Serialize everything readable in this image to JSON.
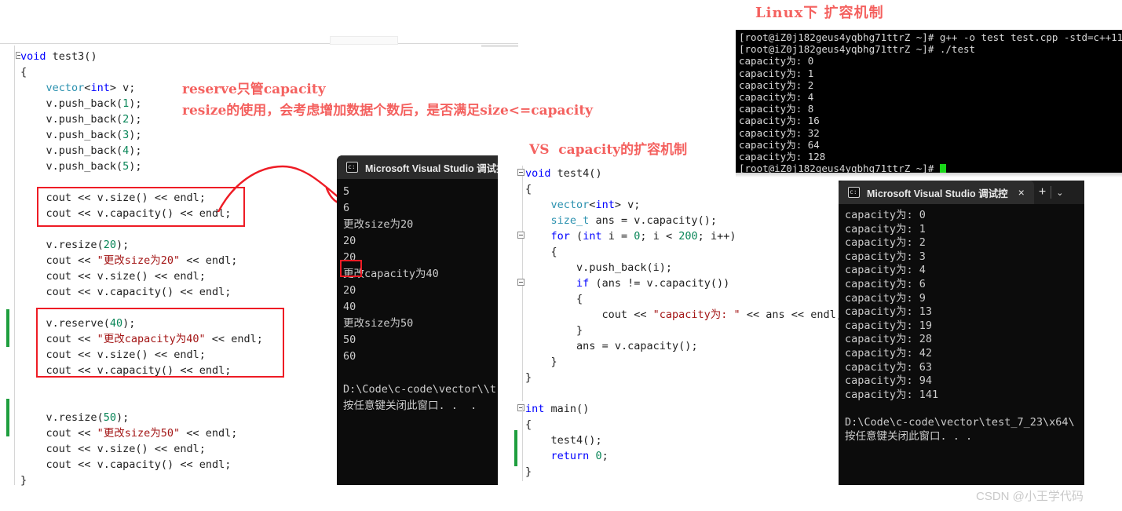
{
  "annotations": {
    "linux_title": "Linux下 扩容机制",
    "reserve_note_line1": "reserve只管capacity",
    "reserve_note_line2": "resize的使用，会考虑增加数据个数后，是否满足size<=capacity",
    "vs_title": "VS  capacity的扩容机制"
  },
  "watermark": "CSDN @小王学代码",
  "code_left": {
    "lines": [
      "void test3()",
      "{",
      "    vector<int> v;",
      "    v.push_back(1);",
      "    v.push_back(2);",
      "    v.push_back(3);",
      "    v.push_back(4);",
      "    v.push_back(5);",
      "",
      "    cout << v.size() << endl;",
      "    cout << v.capacity() << endl;",
      "",
      "    v.resize(20);",
      "    cout << \"更改size为20\" << endl;",
      "    cout << v.size() << endl;",
      "    cout << v.capacity() << endl;",
      "",
      "    v.reserve(40);",
      "    cout << \"更改capacity为40\" << endl;",
      "    cout << v.size() << endl;",
      "    cout << v.capacity() << endl;",
      "",
      "",
      "    v.resize(50);",
      "    cout << \"更改size为50\" << endl;",
      "    cout << v.size() << endl;",
      "    cout << v.capacity() << endl;",
      "}"
    ]
  },
  "code_right": {
    "lines": [
      "void test4()",
      "{",
      "    vector<int> v;",
      "    size_t ans = v.capacity();",
      "    for (int i = 0; i < 200; i++)",
      "    {",
      "        v.push_back(i);",
      "        if (ans != v.capacity())",
      "        {",
      "            cout << \"capacity为: \" << ans << endl;",
      "        }",
      "        ans = v.capacity();",
      "    }",
      "}",
      "",
      "int main()",
      "{",
      "    test4();",
      "    return 0;",
      "}"
    ]
  },
  "console_left": {
    "title": "Microsoft Visual Studio 调试控",
    "lines": [
      "5",
      "6",
      "更改size为20",
      "20",
      "20",
      "更改capacity为40",
      "20",
      "40",
      "更改size为50",
      "50",
      "60",
      "",
      "D:\\Code\\c-code\\vector\\\\t",
      "按任意键关闭此窗口. .  ."
    ]
  },
  "console_right": {
    "title": "Microsoft Visual Studio 调试控",
    "close_icon": "×",
    "plus_icon": "+",
    "chevron_icon": "⌄",
    "lines": [
      "capacity为: 0",
      "capacity为: 1",
      "capacity为: 2",
      "capacity为: 3",
      "capacity为: 4",
      "capacity为: 6",
      "capacity为: 9",
      "capacity为: 13",
      "capacity为: 19",
      "capacity为: 28",
      "capacity为: 42",
      "capacity为: 63",
      "capacity为: 94",
      "capacity为: 141",
      "",
      "D:\\Code\\c-code\\vector\\test_7_23\\x64\\",
      "按任意键关闭此窗口. . ."
    ]
  },
  "terminal": {
    "lines": [
      "[root@iZ0j182geus4yqbhg71ttrZ ~]# g++ -o test test.cpp -std=c++11",
      "[root@iZ0j182geus4yqbhg71ttrZ ~]# ./test",
      "capacity为: 0",
      "capacity为: 1",
      "capacity为: 2",
      "capacity为: 4",
      "capacity为: 8",
      "capacity为: 16",
      "capacity为: 32",
      "capacity为: 64",
      "capacity为: 128"
    ],
    "prompt": "[root@iZ0j182geus4yqbhg71ttrZ ~]# "
  },
  "colors": {
    "annotation_red": "#f4615f",
    "box_red": "#ee1c25",
    "change_bar_green": "#1e9e3e",
    "console_bg": "#0c0c0c",
    "terminal_bg": "#000000"
  }
}
